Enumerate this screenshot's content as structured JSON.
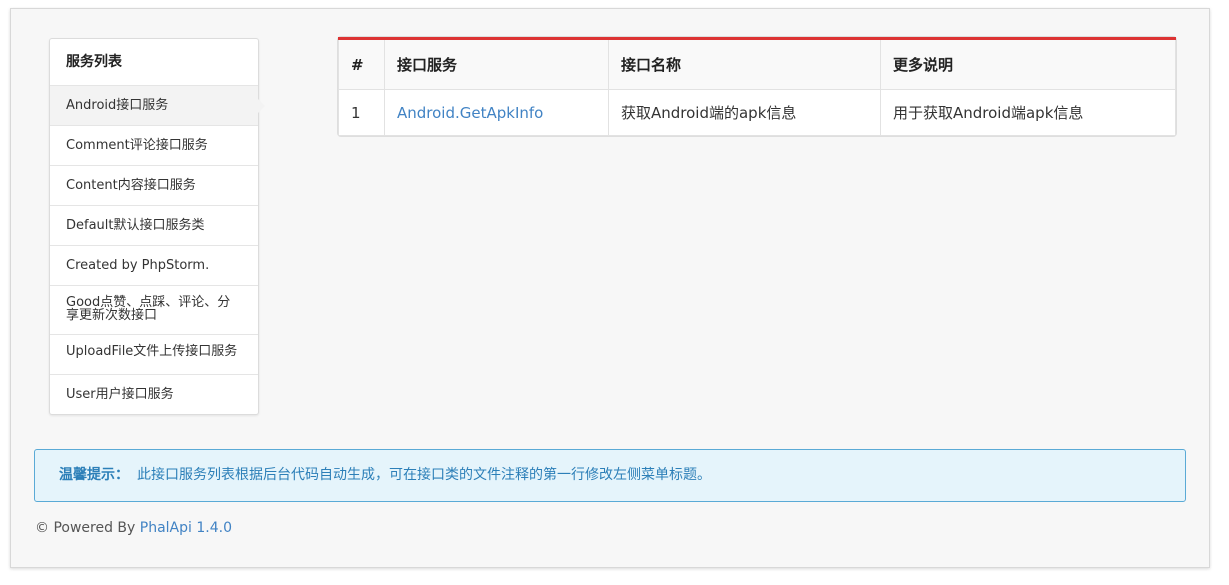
{
  "sidebar": {
    "title": "服务列表",
    "items": [
      {
        "label": "Android接口服务"
      },
      {
        "label": "Comment评论接口服务"
      },
      {
        "label": "Content内容接口服务"
      },
      {
        "label": "Default默认接口服务类"
      },
      {
        "label": "Created by PhpStorm."
      },
      {
        "label": "Good点赞、点踩、评论、分享更新次数接口"
      },
      {
        "label": "UploadFile文件上传接口服务"
      },
      {
        "label": "User用户接口服务"
      }
    ]
  },
  "table": {
    "headers": [
      "#",
      "接口服务",
      "接口名称",
      "更多说明"
    ],
    "rows": [
      {
        "index": "1",
        "service": "Android.GetApkInfo",
        "name": "获取Android端的apk信息",
        "description": "用于获取Android端apk信息"
      }
    ]
  },
  "notice": {
    "title": "温馨提示：",
    "text": "此接口服务列表根据后台代码自动生成，可在接口类的文件注释的第一行修改左侧菜单标题。"
  },
  "footer": {
    "prefix": "© Powered By",
    "link": "PhalApi 1.4.0"
  },
  "colors": {
    "accent_red": "#dd3333",
    "link_blue": "#4183c4",
    "notice_bg": "#e5f4fb",
    "notice_border": "#5aaad6"
  }
}
